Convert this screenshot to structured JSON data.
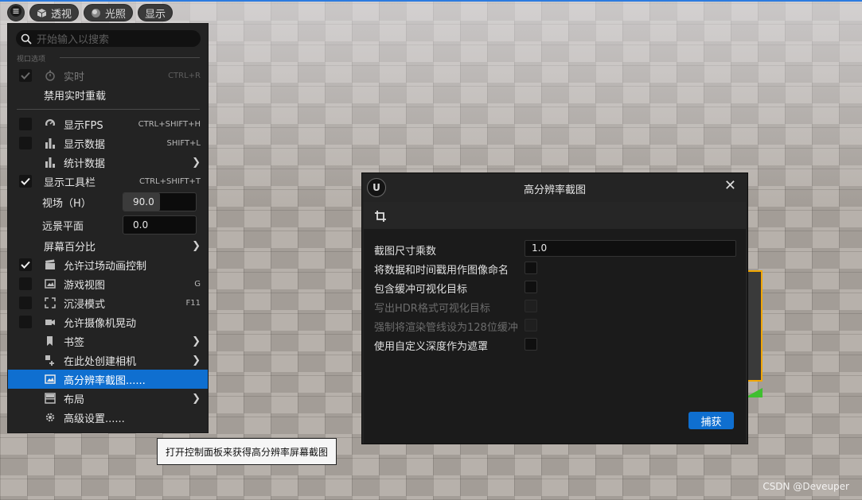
{
  "toolbar": {
    "menu_icon": "hamburger-icon",
    "perspective_label": "透视",
    "lighting_label": "光照",
    "show_label": "显示"
  },
  "menu": {
    "search_placeholder": "开始输入以搜索",
    "section_label": "视口选项",
    "items": [
      {
        "label": "实时",
        "shortcut": "CTRL+R",
        "icon": "stopwatch-icon",
        "checked": true,
        "disabled": true
      },
      {
        "label": "禁用实时重载"
      },
      {
        "label": "显示FPS",
        "shortcut": "CTRL+SHIFT+H",
        "icon": "speedometer-icon",
        "checked": false
      },
      {
        "label": "显示数据",
        "shortcut": "SHIFT+L",
        "icon": "bar-chart-icon",
        "checked": false
      },
      {
        "label": "统计数据",
        "icon": "bar-chart-icon",
        "submenu": true
      },
      {
        "label": "显示工具栏",
        "shortcut": "CTRL+SHIFT+T",
        "checked": true
      },
      {
        "label": "视场（H）",
        "value": "90.0"
      },
      {
        "label": "远景平面",
        "value": "0.0"
      },
      {
        "label": "屏幕百分比",
        "submenu": true
      },
      {
        "label": "允许过场动画控制",
        "icon": "clapperboard-icon",
        "checked": true
      },
      {
        "label": "游戏视图",
        "shortcut": "G",
        "icon": "game-view-icon",
        "checked": false
      },
      {
        "label": "沉浸模式",
        "shortcut": "F11",
        "icon": "fullscreen-icon",
        "checked": false
      },
      {
        "label": "允许摄像机晃动",
        "icon": "camera-icon",
        "checked": false
      },
      {
        "label": "书签",
        "icon": "bookmark-icon",
        "submenu": true
      },
      {
        "label": "在此处创建相机",
        "icon": "add-camera-icon",
        "submenu": true
      },
      {
        "label": "高分辨率截图......",
        "icon": "image-icon",
        "selected": true
      },
      {
        "label": "布局",
        "icon": "layout-icon",
        "submenu": true
      },
      {
        "label": "高级设置......",
        "icon": "gear-icon"
      }
    ],
    "fov_fill_fraction": 0.5
  },
  "tooltip": "打开控制面板来获得高分辨率屏幕截图",
  "dialog": {
    "logo_text": "U",
    "title": "高分辨率截图",
    "close_icon": "close-icon",
    "crop_icon": "crop-icon",
    "fields": [
      {
        "label": "截图尺寸乘数",
        "value": "1.0"
      },
      {
        "label": "将数据和时间戳用作图像命名",
        "checked": false
      },
      {
        "label": "包含缓冲可视化目标",
        "checked": false
      },
      {
        "label": "写出HDR格式可视化目标",
        "checked": false,
        "disabled": true
      },
      {
        "label": "强制将渲染管线设为128位缓冲",
        "checked": false,
        "disabled": true
      },
      {
        "label": "使用自定义深度作为遮罩",
        "checked": false
      }
    ],
    "capture_label": "捕获"
  },
  "watermark": "CSDN @Deveuper",
  "colors": {
    "accent": "#0f6fd0",
    "menu_bg": "#232323",
    "selection_outline": "#f2a700"
  }
}
